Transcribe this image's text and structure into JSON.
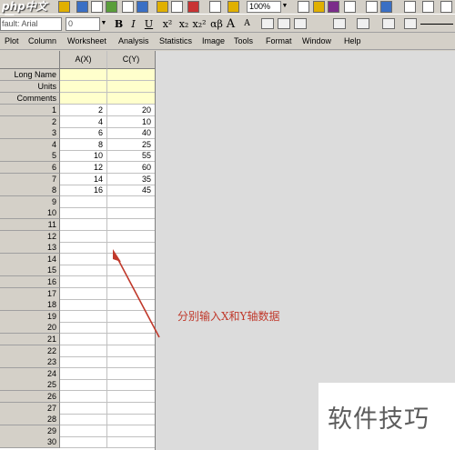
{
  "toolbar1": {
    "logo_text": "php中文网",
    "zoom": "100%",
    "zoom_arrow": "▼"
  },
  "toolbar2": {
    "font_name": "fault: Arial",
    "font_size": "0",
    "size_arrow": "▼",
    "bold": "B",
    "italic": "I",
    "underline": "U",
    "superscript": "x²",
    "subscript": "x₂",
    "supersub": "x₂²",
    "greek": "αβ",
    "increase_font": "A",
    "decrease_font": "A"
  },
  "menubar": {
    "items": [
      "Plot",
      "Column",
      "Worksheet",
      "Analysis",
      "Statistics",
      "Image",
      "Tools",
      "Format",
      "Window",
      "Help"
    ]
  },
  "worksheet": {
    "columns": [
      "A(X)",
      "C(Y)"
    ],
    "meta_rows": [
      "Long Name",
      "Units",
      "Comments"
    ],
    "rows": [
      {
        "n": "1",
        "a": "2",
        "c": "20"
      },
      {
        "n": "2",
        "a": "4",
        "c": "10"
      },
      {
        "n": "3",
        "a": "6",
        "c": "40"
      },
      {
        "n": "4",
        "a": "8",
        "c": "25"
      },
      {
        "n": "5",
        "a": "10",
        "c": "55"
      },
      {
        "n": "6",
        "a": "12",
        "c": "60"
      },
      {
        "n": "7",
        "a": "14",
        "c": "35"
      },
      {
        "n": "8",
        "a": "16",
        "c": "45"
      },
      {
        "n": "9",
        "a": "",
        "c": ""
      },
      {
        "n": "10",
        "a": "",
        "c": ""
      },
      {
        "n": "11",
        "a": "",
        "c": ""
      },
      {
        "n": "12",
        "a": "",
        "c": ""
      },
      {
        "n": "13",
        "a": "",
        "c": ""
      },
      {
        "n": "14",
        "a": "",
        "c": ""
      },
      {
        "n": "15",
        "a": "",
        "c": ""
      },
      {
        "n": "16",
        "a": "",
        "c": ""
      },
      {
        "n": "17",
        "a": "",
        "c": ""
      },
      {
        "n": "18",
        "a": "",
        "c": ""
      },
      {
        "n": "19",
        "a": "",
        "c": ""
      },
      {
        "n": "20",
        "a": "",
        "c": ""
      },
      {
        "n": "21",
        "a": "",
        "c": ""
      },
      {
        "n": "22",
        "a": "",
        "c": ""
      },
      {
        "n": "23",
        "a": "",
        "c": ""
      },
      {
        "n": "24",
        "a": "",
        "c": ""
      },
      {
        "n": "25",
        "a": "",
        "c": ""
      },
      {
        "n": "26",
        "a": "",
        "c": ""
      },
      {
        "n": "27",
        "a": "",
        "c": ""
      },
      {
        "n": "28",
        "a": "",
        "c": ""
      },
      {
        "n": "29",
        "a": "",
        "c": ""
      },
      {
        "n": "30",
        "a": "",
        "c": ""
      }
    ]
  },
  "annotation": {
    "text": "分别输入X和Y轴数据",
    "color": "#c0392b"
  },
  "watermark": {
    "text": "软件技巧"
  },
  "colors": {
    "meta_bg": "#ffffcc",
    "header_bg": "#d4d0c8",
    "workspace_bg": "#dcdcdc"
  }
}
